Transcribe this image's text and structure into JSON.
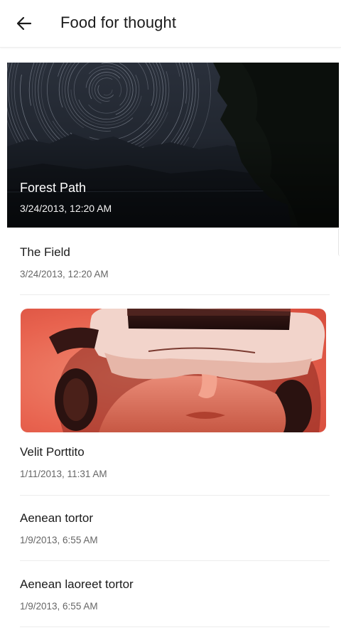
{
  "header": {
    "title": "Food for thought",
    "back_icon": "arrow-left-icon"
  },
  "colors": {
    "hero_sky": "#232832",
    "vr_accent": "#e8634f",
    "divider": "#ececec"
  },
  "featured": {
    "title": "Forest Path",
    "date": "3/24/2013, 12:20 AM"
  },
  "items": [
    {
      "title": "The Field",
      "date": "3/24/2013, 12:20 AM"
    },
    {
      "title": "Velit Porttito",
      "date": "1/11/2013, 11:31 AM"
    },
    {
      "title": "Aenean tortor",
      "date": "1/9/2013, 6:55 AM"
    },
    {
      "title": "Aenean laoreet tortor",
      "date": "1/9/2013, 6:55 AM"
    }
  ]
}
